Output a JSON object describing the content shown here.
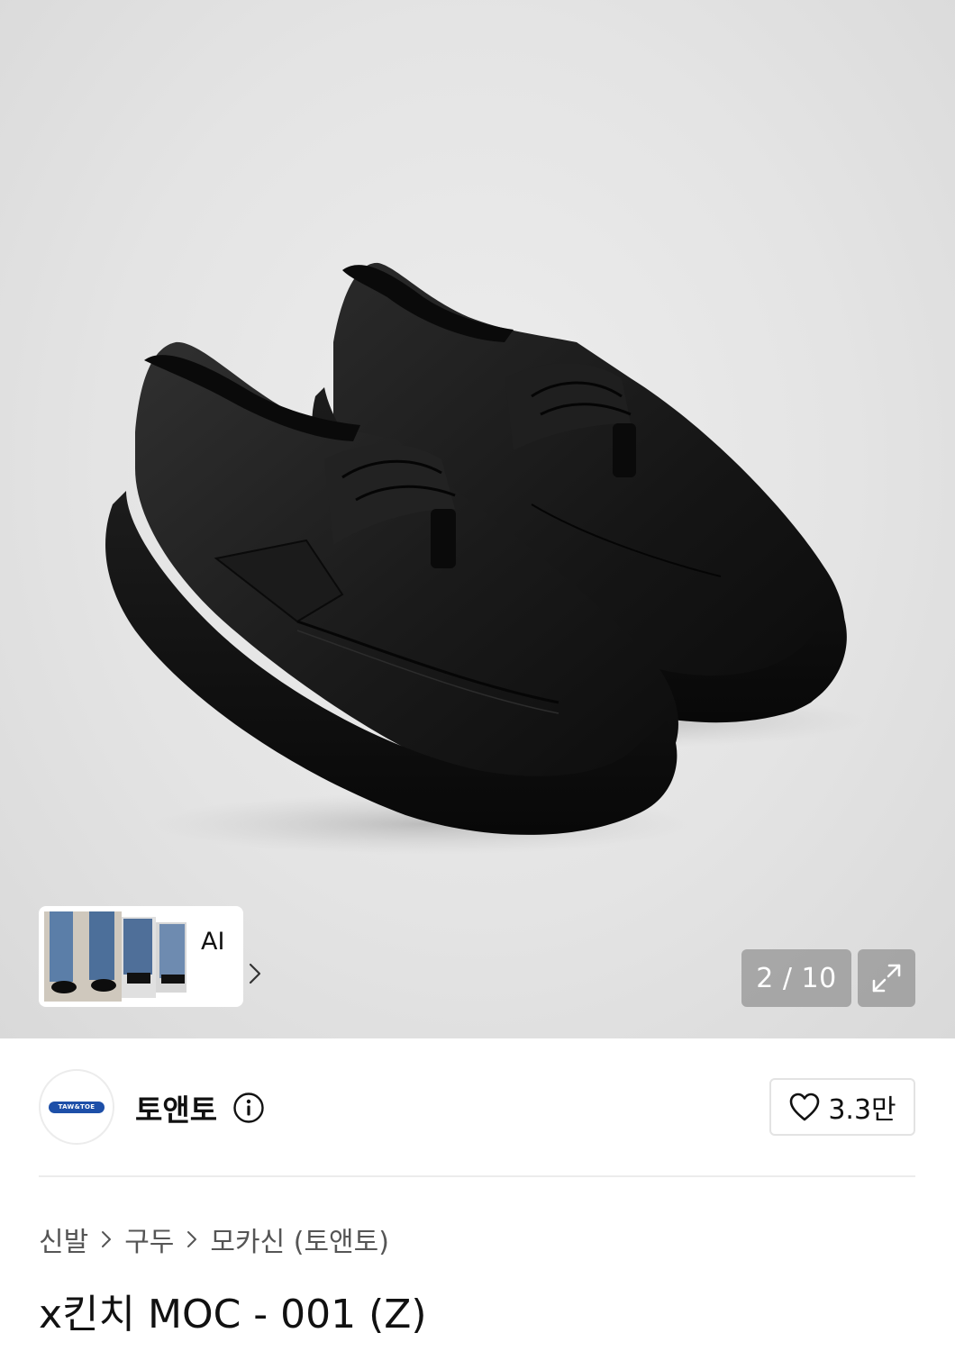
{
  "gallery": {
    "image_alt": "black leather moccasin shoes",
    "counter": "2 / 10",
    "ai_card": {
      "label": "AI"
    }
  },
  "brand": {
    "logo_text": "TAW&TOE",
    "name": "토앤토",
    "like_count": "3.3만"
  },
  "breadcrumb": [
    "신발",
    "구두",
    "모카신 (토앤토)"
  ],
  "product": {
    "title": "x킨치 MOC - 001 (Z)"
  },
  "colors": {
    "brand_blue": "#1d4fa8",
    "overlay": "rgba(120,120,120,0.55)"
  }
}
